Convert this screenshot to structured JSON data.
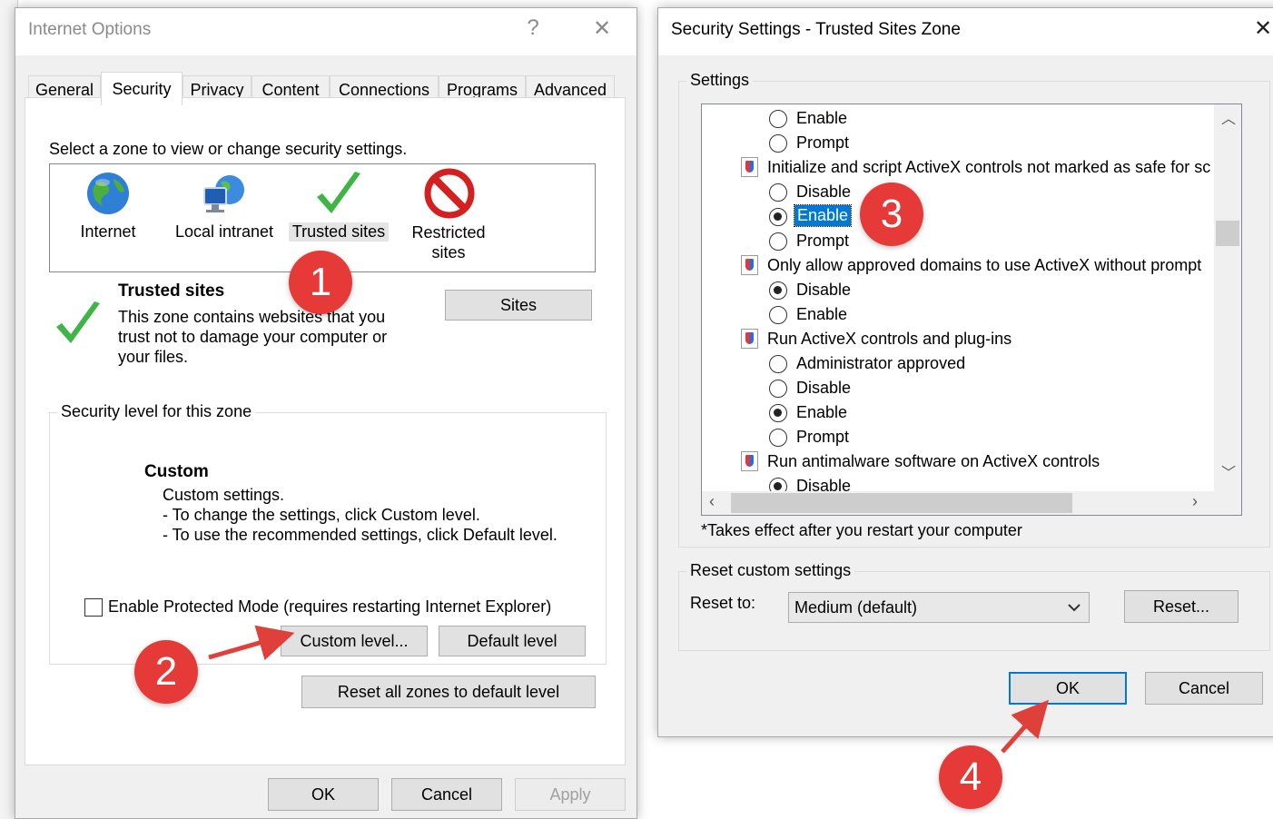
{
  "left_window": {
    "title": "Internet Options",
    "help_glyph": "?",
    "close_glyph": "✕",
    "tabs": [
      "General",
      "Security",
      "Privacy",
      "Content",
      "Connections",
      "Programs",
      "Advanced"
    ],
    "active_tab": "Security",
    "zone_prompt": "Select a zone to view or change security settings.",
    "zones": [
      {
        "label": "Internet",
        "icon": "globe-icon"
      },
      {
        "label": "Local intranet",
        "icon": "intranet-icon"
      },
      {
        "label": "Trusted sites",
        "icon": "checkmark-icon",
        "selected": true
      },
      {
        "label": "Restricted\nsites",
        "icon": "restricted-icon"
      }
    ],
    "zone_info": {
      "heading": "Trusted sites",
      "description": "This zone contains websites that you trust not to damage your computer or your files."
    },
    "sites_button": "Sites",
    "security_level": {
      "legend": "Security level for this zone",
      "level_title": "Custom",
      "lines": [
        "Custom settings.",
        "- To change the settings, click Custom level.",
        "- To use the recommended settings, click Default level."
      ]
    },
    "protected_mode": {
      "label": "Enable Protected Mode (requires restarting Internet Explorer)",
      "checked": false
    },
    "custom_level_button": "Custom level...",
    "default_level_button": "Default level",
    "reset_all_button": "Reset all zones to default level",
    "ok_button": "OK",
    "cancel_button": "Cancel",
    "apply_button": "Apply"
  },
  "right_window": {
    "title": "Security Settings - Trusted Sites Zone",
    "close_glyph": "✕",
    "settings_legend": "Settings",
    "settings_items": [
      {
        "kind": "option",
        "label": "Enable",
        "checked": false
      },
      {
        "kind": "option",
        "label": "Prompt",
        "checked": false
      },
      {
        "kind": "setting",
        "label": "Initialize and script ActiveX controls not marked as safe for sc"
      },
      {
        "kind": "option",
        "label": "Disable",
        "checked": false
      },
      {
        "kind": "option",
        "label": "Enable",
        "checked": true,
        "highlighted": true
      },
      {
        "kind": "option",
        "label": "Prompt",
        "checked": false
      },
      {
        "kind": "setting",
        "label": "Only allow approved domains to use ActiveX without prompt"
      },
      {
        "kind": "option",
        "label": "Disable",
        "checked": true
      },
      {
        "kind": "option",
        "label": "Enable",
        "checked": false
      },
      {
        "kind": "setting",
        "label": "Run ActiveX controls and plug-ins"
      },
      {
        "kind": "option",
        "label": "Administrator approved",
        "checked": false
      },
      {
        "kind": "option",
        "label": "Disable",
        "checked": false
      },
      {
        "kind": "option",
        "label": "Enable",
        "checked": true
      },
      {
        "kind": "option",
        "label": "Prompt",
        "checked": false
      },
      {
        "kind": "setting",
        "label": "Run antimalware software on ActiveX controls"
      },
      {
        "kind": "option",
        "label": "Disable",
        "checked": true
      }
    ],
    "restart_note": "*Takes effect after you restart your computer",
    "reset_legend": "Reset custom settings",
    "reset_to_label": "Reset to:",
    "reset_to_value": "Medium (default)",
    "reset_button": "Reset...",
    "ok_button": "OK",
    "cancel_button": "Cancel"
  },
  "annotations": {
    "step1": "1",
    "step2": "2",
    "step3": "3",
    "step4": "4",
    "badge_color": "#e53a37",
    "arrow_color": "#e0403a"
  },
  "colors": {
    "accent": "#0078d7",
    "selection": "#0078d7",
    "dialog_bg": "#f0f0f0"
  }
}
